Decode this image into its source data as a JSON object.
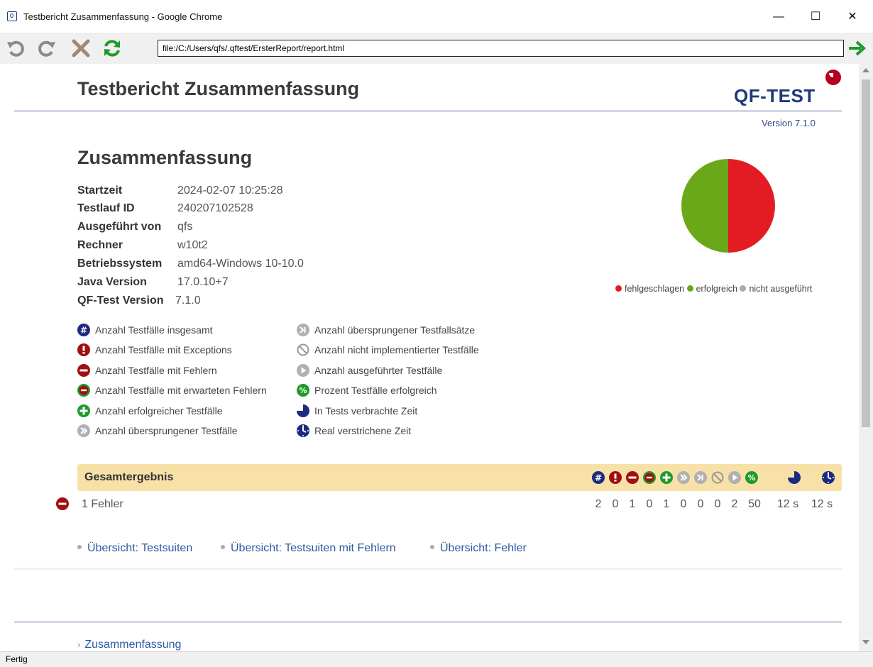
{
  "window": {
    "title": "Testbericht Zusammenfassung - Google Chrome",
    "minimize": "—",
    "maximize": "☐",
    "close": "✕"
  },
  "toolbar": {
    "url": "file:/C:/Users/qfs/.qftest/ErsterReport/report.html"
  },
  "status": {
    "text": "Fertig"
  },
  "page": {
    "title": "Testbericht Zusammenfassung",
    "logo": "QF-TEST",
    "version": "Version 7.1.0",
    "summary_heading": "Zusammenfassung",
    "info": [
      {
        "key": "Startzeit",
        "value": "2024-02-07 10:25:28"
      },
      {
        "key": "Testlauf ID",
        "value": "240207102528"
      },
      {
        "key": "Ausgeführt von",
        "value": "qfs"
      },
      {
        "key": "Rechner",
        "value": "w10t2"
      },
      {
        "key": "Betriebssystem",
        "value": "amd64-Windows 10-10.0"
      },
      {
        "key": "Java Version",
        "value": "17.0.10+7"
      },
      {
        "key": "QF-Test Version",
        "value": "7.1.0"
      }
    ],
    "pie": {
      "legend": [
        "fehlgeschlagen",
        "erfolgreich",
        "nicht ausgeführt"
      ],
      "colors": {
        "failed": "#e31c23",
        "passed": "#6aa81a",
        "notrun": "#a8a8a8"
      },
      "values": {
        "failed": 50,
        "passed": 50,
        "notrun": 0
      }
    },
    "key_left": [
      {
        "icon": "hash-icon",
        "label": "Anzahl Testfälle insgesamt"
      },
      {
        "icon": "exception-icon",
        "label": "Anzahl Testfälle mit Exceptions"
      },
      {
        "icon": "error-icon",
        "label": "Anzahl Testfälle mit Fehlern"
      },
      {
        "icon": "expected-error-icon",
        "label": "Anzahl Testfälle mit erwarteten Fehlern"
      },
      {
        "icon": "success-icon",
        "label": "Anzahl erfolgreicher Testfälle"
      },
      {
        "icon": "skipped-icon",
        "label": "Anzahl übersprungener Testfälle"
      }
    ],
    "key_right": [
      {
        "icon": "skipped-sets-icon",
        "label": "Anzahl übersprungener Testfallsätze"
      },
      {
        "icon": "not-implemented-icon",
        "label": "Anzahl nicht implementierter Testfälle"
      },
      {
        "icon": "executed-icon",
        "label": "Anzahl ausgeführter Testfälle"
      },
      {
        "icon": "percent-icon",
        "label": "Prozent Testfälle erfolgreich"
      },
      {
        "icon": "time-icon",
        "label": "In Tests verbrachte Zeit"
      },
      {
        "icon": "clock-icon",
        "label": "Real verstrichene Zeit"
      }
    ],
    "result": {
      "heading": "Gesamtergebnis",
      "label": "1 Fehler",
      "values": [
        "2",
        "0",
        "1",
        "0",
        "1",
        "0",
        "0",
        "0",
        "2",
        "50",
        "12 s",
        "12 s"
      ]
    },
    "links": [
      "Übersicht: Testsuiten",
      "Übersicht: Testsuiten mit Fehlern",
      "Übersicht: Fehler"
    ],
    "bottom_link": "Zusammenfassung"
  }
}
